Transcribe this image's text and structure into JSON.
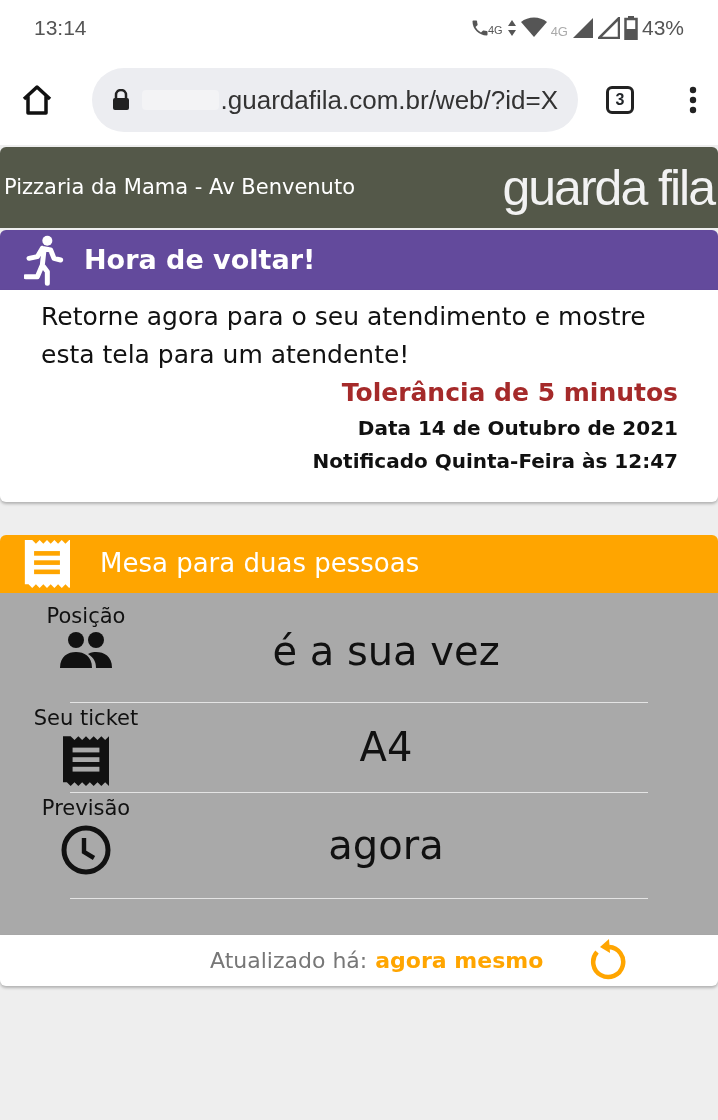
{
  "status_bar": {
    "time": "13:14",
    "network_label": "4G",
    "data_label": "4G",
    "battery": "43%"
  },
  "browser": {
    "url": ".guardafila.com.br/web/?id=X",
    "tab_count": "3"
  },
  "header": {
    "store": "Pizzaria da Mama - Av Benvenuto",
    "logo": "guarda fila"
  },
  "alert": {
    "title": "Hora de voltar!",
    "message": "Retorne agora para o seu atendimento e mostre esta tela para um atendente!",
    "tolerance": "Tolerância de 5 minutos",
    "date": "Data 14 de Outubro de 2021",
    "notified": "Notificado Quinta-Feira às 12:47"
  },
  "queue": {
    "title": "Mesa para duas pessoas",
    "rows": [
      {
        "kind": "position",
        "label": "Posição",
        "value": "é a sua vez"
      },
      {
        "kind": "ticket",
        "label": "Seu ticket",
        "value": "A4"
      },
      {
        "kind": "forecast",
        "label": "Previsão",
        "value": "agora"
      }
    ],
    "updated_label": "Atualizado há:",
    "updated_value": "agora mesmo"
  }
}
